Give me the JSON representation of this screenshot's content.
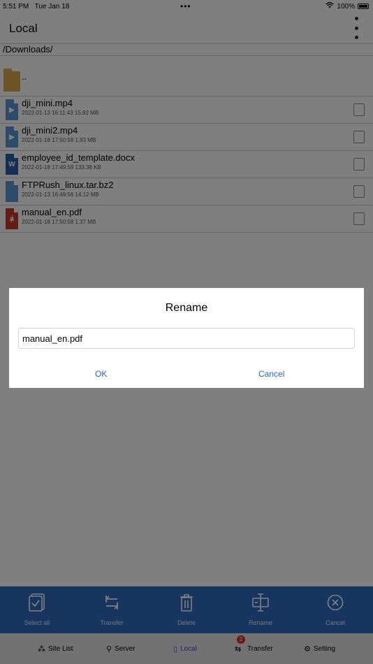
{
  "status_bar": {
    "time": "5:51 PM",
    "date": "Tue Jan 18",
    "battery": "100%"
  },
  "nav": {
    "title": "Local"
  },
  "path": "/Downloads/",
  "parent_label": "..",
  "files": [
    {
      "name": "dji_mini.mp4",
      "meta": "2022-01-13 16:11:43  15.82 MB",
      "icon": "video-file-icon"
    },
    {
      "name": "dji_mini2.mp4",
      "meta": "2022-01-18 17:50:58  1.93 MB",
      "icon": "video-file-icon"
    },
    {
      "name": "employee_id_template.docx",
      "meta": "2022-01-18 17:49:59  133.38 KB",
      "icon": "word-file-icon"
    },
    {
      "name": "FTPRush_linux.tar.bz2",
      "meta": "2022-01-13 16:49:56  14.12 MB",
      "icon": "archive-file-icon"
    },
    {
      "name": "manual_en.pdf",
      "meta": "2022-01-18 17:50:58  1.37 MB",
      "icon": "pdf-file-icon"
    }
  ],
  "dialog": {
    "title": "Rename",
    "input_value": "manual_en.pdf",
    "ok_label": "OK",
    "cancel_label": "Cancel"
  },
  "actions": [
    {
      "label": "Select all",
      "icon": "select-all-icon"
    },
    {
      "label": "Transfer",
      "icon": "transfer-arrows-icon"
    },
    {
      "label": "Delete",
      "icon": "trash-icon"
    },
    {
      "label": "Rename",
      "icon": "rename-icon"
    },
    {
      "label": "Cancel",
      "icon": "cancel-circle-icon"
    }
  ],
  "tabs": [
    {
      "label": "Site List",
      "icon": "sitemap-icon"
    },
    {
      "label": "Server",
      "icon": "server-icon"
    },
    {
      "label": "Local",
      "icon": "phone-icon",
      "active": true
    },
    {
      "label": "Transfer",
      "icon": "transfer-icon",
      "badge": "2"
    },
    {
      "label": "Setting",
      "icon": "gear-icon"
    }
  ],
  "colors": {
    "accent": "#2d6cc0",
    "active_tab": "#4a4fd0",
    "badge": "#d6332a",
    "link": "#2a62c9"
  }
}
